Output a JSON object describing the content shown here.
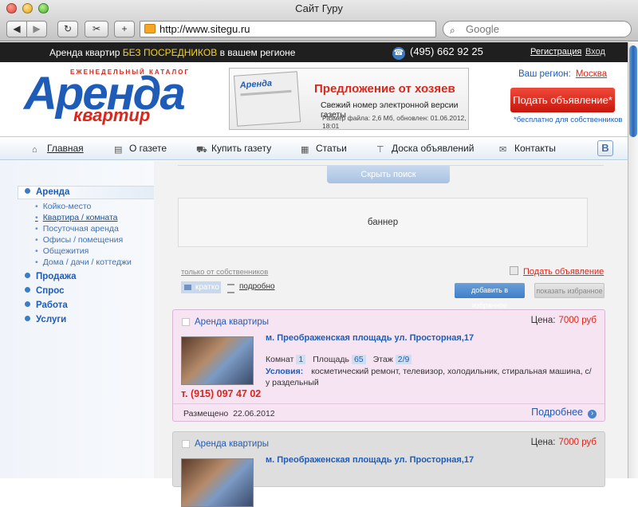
{
  "browser": {
    "window_title": "Сайт Гуру",
    "url": "http://www.sitegu.ru",
    "search_placeholder": "Google",
    "back_glyph": "◀",
    "forward_glyph": "▶",
    "reload_glyph": "↻",
    "bookmark_glyph": "✂",
    "add_glyph": "+",
    "search_glyph": "⌕"
  },
  "topbar": {
    "slogan_before": "Аренда квартир ",
    "slogan_highlight": "БЕЗ ПОСРЕДНИКОВ",
    "slogan_after": " в вашем регионе",
    "phone_icon": "☎",
    "phone": "(495) 662 92 25",
    "register": "Регистрация",
    "login": "Вход"
  },
  "header": {
    "logo_subtitle": "ЕЖЕНЕДЕЛЬНЫЙ КАТАЛОГ",
    "logo_main": "Аренда",
    "logo_second": "квартир",
    "banner_paper_title": "Аренда",
    "banner_title": "Предложение от хозяев",
    "banner_subtitle": "Свежий номер электронной версии газеты",
    "banner_info": "Размер файла: 2,6 Мб, обновлен: 01.06.2012, 18:01",
    "region_label": "Ваш регион:",
    "region_value": "Москва",
    "post_button": "Подать объявление*",
    "post_note": "*бесплатно для собственников"
  },
  "nav": {
    "items": [
      {
        "label": "Главная",
        "icon": "⌂"
      },
      {
        "label": "О газете",
        "icon": "▤"
      },
      {
        "label": "Купить газету",
        "icon": "⛟"
      },
      {
        "label": "Статьи",
        "icon": "▦"
      },
      {
        "label": "Доска объявлений",
        "icon": "⊤"
      },
      {
        "label": "Контакты",
        "icon": "✉"
      }
    ],
    "vk": "B"
  },
  "sidebar": {
    "sections": [
      "Аренда",
      "Продажа",
      "Спрос",
      "Работа",
      "Услуги"
    ],
    "subitems": [
      "Койко-место",
      "Квартира / комната",
      "Посуточная аренда",
      "Офисы / помещения",
      "Общежития",
      "Дома / дачи / коттеджи"
    ]
  },
  "content": {
    "hide_search": "Скрыть поиск",
    "banner_placeholder": "баннер",
    "owners_only": "только от собственников",
    "add_ad": "Подать объявление",
    "view_brief": "кратко",
    "view_detailed": "подробно",
    "add_favorite": "добавить в избранное",
    "show_favorite": "показать избранное"
  },
  "listings": [
    {
      "title": "Аренда квартиры",
      "price_label": "Цена:",
      "price": "7000 руб",
      "address": "м. Преображенская площадь  ул. Просторная,17",
      "rooms_label": "Комнат",
      "rooms": "1",
      "area_label": "Площадь",
      "area": "65",
      "floor_label": "Этаж",
      "floor": "2/9",
      "conditions_label": "Условия:",
      "conditions": "косметический ремонт, телевизор, холодильник, стиральная машина, с/у раздельный",
      "phone": "т. (915) 097 47 02",
      "posted_label": "Размещено",
      "posted_date": "22.06.2012",
      "more": "Подробнее"
    },
    {
      "title": "Аренда квартиры",
      "price_label": "Цена:",
      "price": "7000 руб",
      "address": "м. Преображенская площадь  ул. Просторная,17"
    }
  ]
}
